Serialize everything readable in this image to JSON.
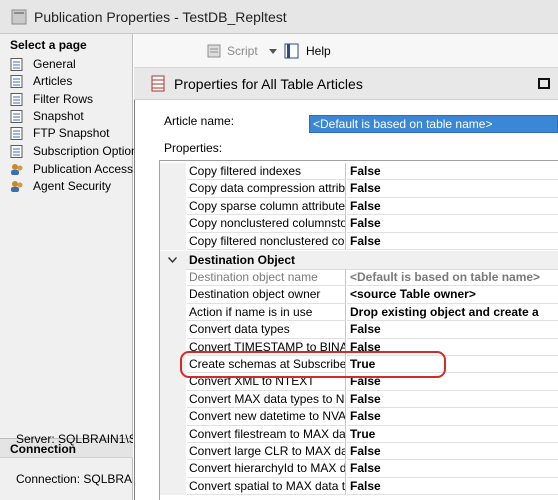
{
  "outer": {
    "title": "Publication Properties - TestDB_Repltest",
    "select_page": "Select a page",
    "nav": [
      {
        "label": "General",
        "icon": "page-icon"
      },
      {
        "label": "Articles",
        "icon": "page-icon"
      },
      {
        "label": "Filter Rows",
        "icon": "page-icon"
      },
      {
        "label": "Snapshot",
        "icon": "page-icon"
      },
      {
        "label": "FTP Snapshot",
        "icon": "page-icon"
      },
      {
        "label": "Subscription Option",
        "icon": "page-icon"
      },
      {
        "label": "Publication Access",
        "icon": "users-icon"
      },
      {
        "label": "Agent Security",
        "icon": "users-icon"
      }
    ],
    "toolbar": {
      "script": "Script",
      "help": "Help"
    },
    "connection": {
      "header": "Connection",
      "server": "Server: SQLBRAIN1\\S",
      "connection": "Connection: SQLBRAI"
    }
  },
  "dialog": {
    "title": "Properties for All Table Articles",
    "article_name_label": "Article name:",
    "article_name_value": "<Default is based on table name>",
    "properties_label": "Properties:",
    "rows_top": [
      {
        "name": "Copy filtered indexes",
        "value": "False"
      },
      {
        "name": "Copy data compression attribu",
        "value": "False"
      },
      {
        "name": "Copy sparse column attribute",
        "value": "False"
      },
      {
        "name": "Copy nonclustered columnstor",
        "value": "False"
      },
      {
        "name": "Copy filtered nonclustered colu",
        "value": "False"
      }
    ],
    "category": "Destination Object",
    "rows_dest": [
      {
        "name": "Destination object name",
        "value": "<Default is based on table name>",
        "disabled": true
      },
      {
        "name": "Destination object owner",
        "value": "<source Table owner>"
      },
      {
        "name": "Action if name is in use",
        "value": "Drop existing object and create a"
      },
      {
        "name": "Convert data types",
        "value": "False"
      },
      {
        "name": "Convert TIMESTAMP to BINA",
        "value": "False"
      },
      {
        "name": "Create schemas at Subscriber",
        "value": "True"
      },
      {
        "name": "Convert XML to NTEXT",
        "value": "False"
      },
      {
        "name": "Convert MAX data types to N",
        "value": "False"
      },
      {
        "name": "Convert new datetime to NVA",
        "value": "False"
      },
      {
        "name": "Convert filestream to MAX dat",
        "value": "True"
      },
      {
        "name": "Convert large CLR to MAX da",
        "value": "False"
      },
      {
        "name": "Convert hierarchyId to MAX d",
        "value": "False"
      },
      {
        "name": "Convert spatial to MAX data ty",
        "value": "False"
      }
    ]
  }
}
